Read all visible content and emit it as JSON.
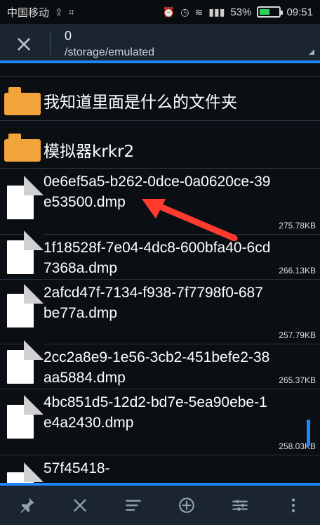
{
  "status_bar": {
    "carrier": "中国移动",
    "battery_percent": "53%",
    "battery_level": 0.53,
    "time": "09:51",
    "icons": [
      "signal-icon",
      "usb-icon",
      "screenshot-icon",
      "alarm-icon",
      "clock-icon",
      "wifi-icon",
      "cell-signal-icon",
      "battery-icon"
    ]
  },
  "toolbar": {
    "close_icon": "close-icon",
    "title": "0",
    "path": "/storage/emulated"
  },
  "list": {
    "items": [
      {
        "type": "folder",
        "name": "我知道里面是什么的文件夹",
        "icon": "folder-icon"
      },
      {
        "type": "folder",
        "name": "模拟器krkr2",
        "icon": "folder-icon"
      },
      {
        "type": "file",
        "name": "0e6ef5a5-b262-0dce-0a0620ce-39e53500.dmp",
        "size": "275.78KB",
        "icon": "file-icon"
      },
      {
        "type": "file",
        "name": "1f18528f-7e04-4dc8-600bfa40-6cd7368a.dmp",
        "size": "266.13KB",
        "icon": "file-icon"
      },
      {
        "type": "file",
        "name": "2afcd47f-7134-f938-7f7798f0-687be77a.dmp",
        "size": "257.79KB",
        "icon": "file-icon"
      },
      {
        "type": "file",
        "name": "2cc2a8e9-1e56-3cb2-451befe2-38aa5884.dmp",
        "size": "265.37KB",
        "icon": "file-icon"
      },
      {
        "type": "file",
        "name": "4bc851d5-12d2-bd7e-5ea90ebe-1e4a2430.dmp",
        "size": "258.03KB",
        "icon": "file-icon"
      },
      {
        "type": "file",
        "name": "57f45418-",
        "size": "",
        "icon": "file-icon"
      }
    ]
  },
  "annotation": {
    "arrow_color": "#ff3b2f"
  },
  "bottom_bar": {
    "buttons": [
      "pin-icon",
      "close-icon",
      "sort-icon",
      "add-circle-icon",
      "filter-icon",
      "more-vert-icon"
    ]
  },
  "colors": {
    "accent": "#1e88ff",
    "folder": "#f2a33a"
  }
}
